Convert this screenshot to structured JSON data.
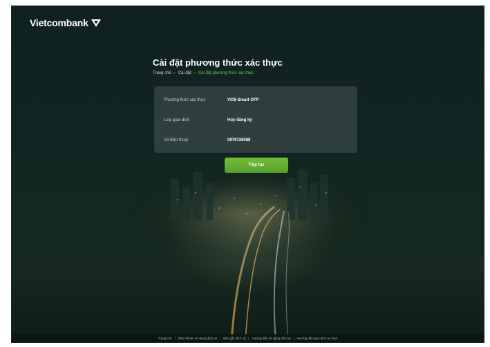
{
  "brand": {
    "name": "Vietcombank"
  },
  "page": {
    "title": "Cài đặt phương thức xác thực",
    "breadcrumb": [
      "Trang chủ",
      "Cài đặt",
      "Cài đặt phương thức xác thực"
    ],
    "breadcrumb_separator": "›"
  },
  "details": [
    {
      "label": "Phương thức xác thực",
      "value": "VCB-Smart OTP"
    },
    {
      "label": "Loại giao dịch",
      "value": "Hủy đăng ký"
    },
    {
      "label": "Số điện thoại",
      "value": "0979726088"
    }
  ],
  "actions": {
    "continue_label": "Tiếp tục"
  },
  "footer": {
    "links": [
      "Trang chủ",
      "Điều khoản sử dụng dịch vụ",
      "Biểu phí dịch vụ",
      "Hướng dẫn sử dụng dịch vụ",
      "Hướng dẫn giao dịch an toàn"
    ],
    "separator": "|"
  },
  "colors": {
    "accent": "#6cb432",
    "background": "#102422",
    "card": "#3c4a48"
  }
}
